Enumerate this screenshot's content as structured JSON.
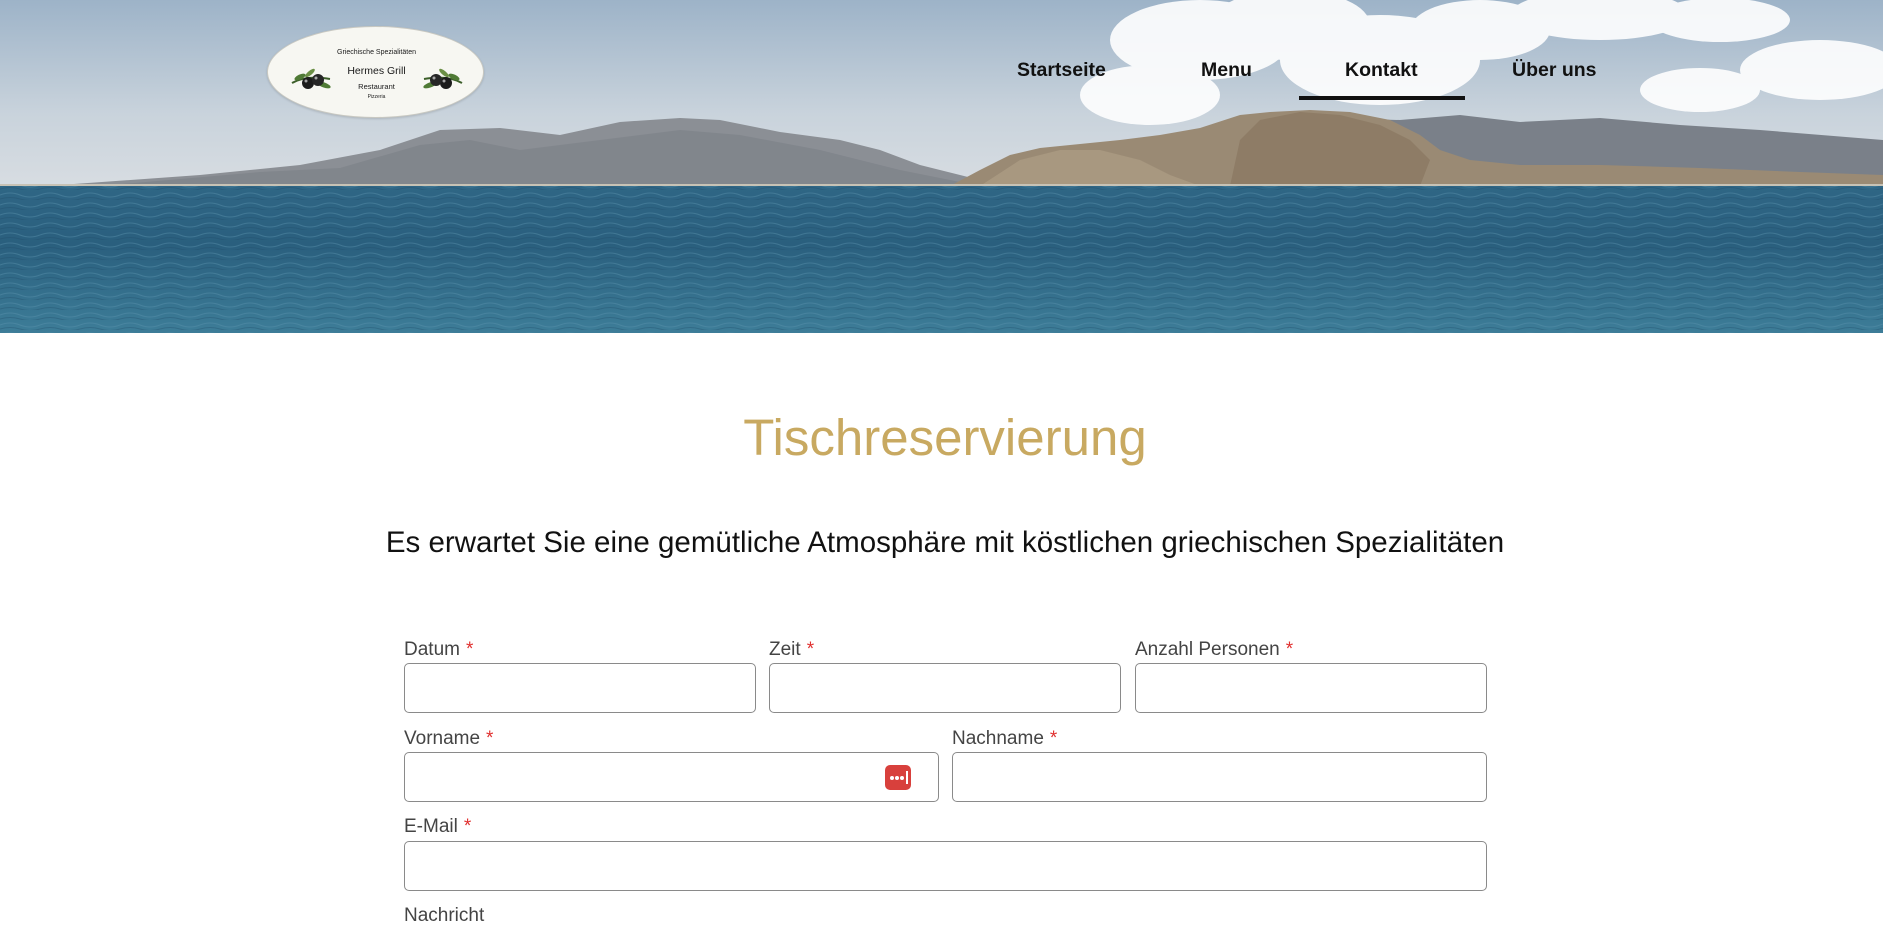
{
  "header": {
    "logo": {
      "subtitle": "Griechische Spezialitäten",
      "name": "Hermes Grill",
      "type": "Restaurant",
      "extra": "Pizzeria"
    },
    "nav": [
      {
        "label": "Startseite",
        "active": false
      },
      {
        "label": "Menu",
        "active": false
      },
      {
        "label": "Kontakt",
        "active": true
      },
      {
        "label": "Über uns",
        "active": false
      }
    ]
  },
  "main": {
    "title": "Tischreservierung",
    "subtitle": "Es erwartet Sie eine gemütliche Atmosphäre mit köstlichen griechischen Spezialitäten"
  },
  "form": {
    "date": {
      "label": "Datum",
      "value": ""
    },
    "time": {
      "label": "Zeit",
      "value": ""
    },
    "persons": {
      "label": "Anzahl Personen",
      "value": ""
    },
    "first_name": {
      "label": "Vorname",
      "value": ""
    },
    "last_name": {
      "label": "Nachname",
      "value": ""
    },
    "email": {
      "label": "E-Mail",
      "value": ""
    },
    "message": {
      "label": "Nachricht"
    },
    "required_marker": "*"
  },
  "icons": {
    "password_manager": "password-manager-icon",
    "olive": "olive-branch-icon"
  },
  "colors": {
    "title": "#c8a961",
    "required": "#e0302f",
    "password_manager": "#d8403c"
  }
}
